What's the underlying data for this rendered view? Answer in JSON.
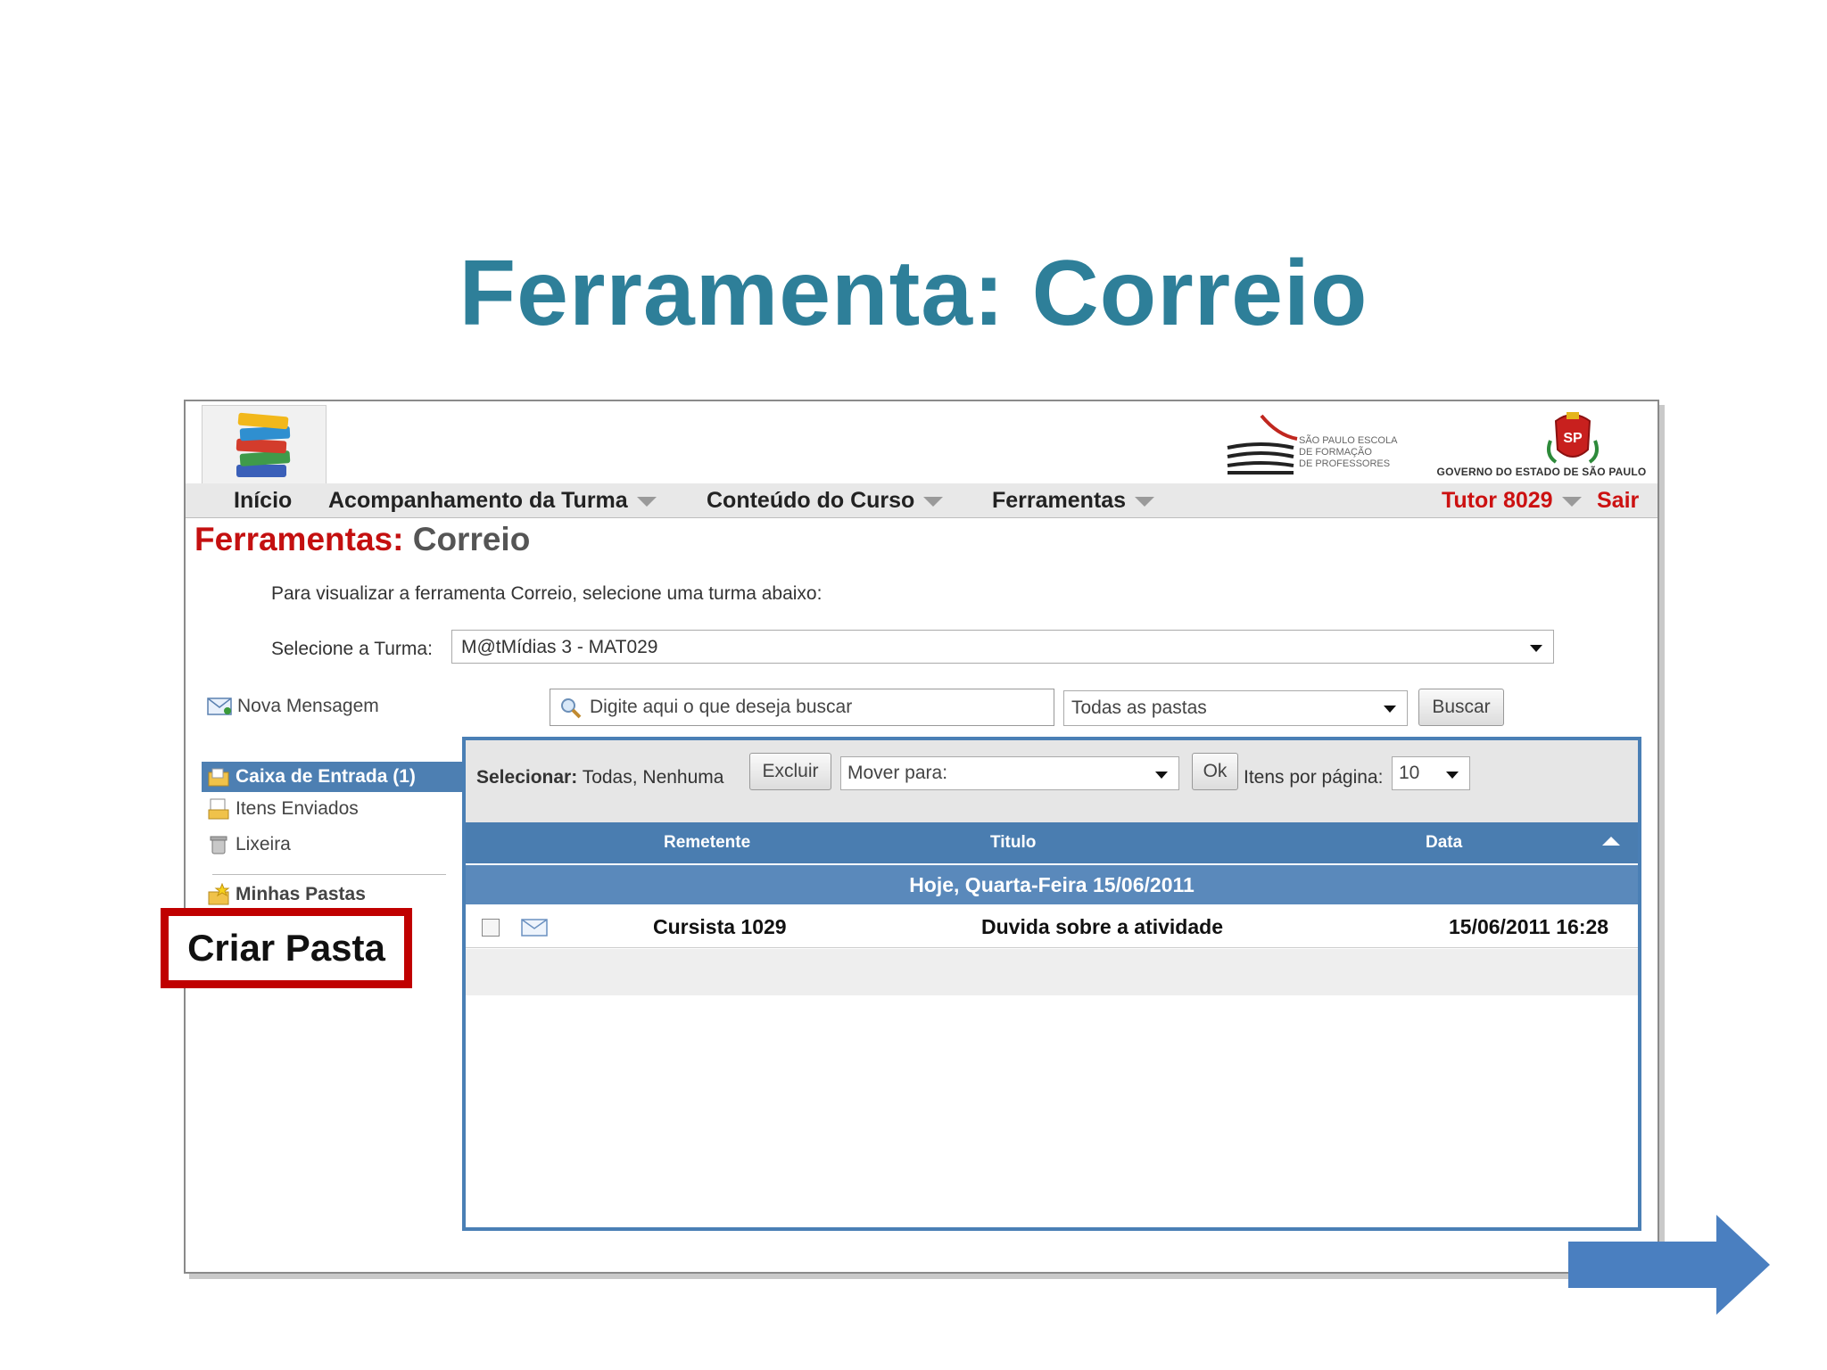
{
  "slide": {
    "title": "Ferramenta: Correio"
  },
  "nav": {
    "home": "Início",
    "acompanhamento": "Acompanhamento da Turma",
    "conteudo": "Conteúdo do Curso",
    "ferramentas": "Ferramentas",
    "tutor": "Tutor 8029",
    "sair": "Sair"
  },
  "logos": {
    "efap_lines": [
      "SÃO PAULO ESCOLA",
      "DE FORMAÇÃO",
      "DE PROFESSORES"
    ],
    "gov": "GOVERNO DO ESTADO DE SÃO PAULO"
  },
  "page": {
    "heading_red": "Ferramentas:",
    "heading_gray": "Correio",
    "intro": "Para visualizar a ferramenta Correio, selecione uma turma abaixo:",
    "select_label": "Selecione a Turma:",
    "select_value": "M@tMídias 3 - MAT029"
  },
  "mail": {
    "new_message": "Nova Mensagem",
    "search_placeholder": "Digite aqui o que deseja buscar",
    "folders_select": "Todas as pastas",
    "search_button": "Buscar"
  },
  "sidebar": {
    "inbox": "Caixa de Entrada (1)",
    "sent": "Itens Enviados",
    "trash": "Lixeira",
    "my_folders": "Minhas Pastas",
    "create_folder": "Criar Pasta"
  },
  "toolbar": {
    "select_label": "Selecionar:",
    "select_all": "Todas,",
    "select_none": "Nenhuma",
    "delete_button": "Excluir",
    "move_placeholder": "Mover para:",
    "ok_button": "Ok",
    "per_page_label": "Itens por página:",
    "per_page_value": "10"
  },
  "table": {
    "headers": [
      "Remetente",
      "Titulo",
      "Data"
    ],
    "group_label": "Hoje, Quarta-Feira 15/06/2011",
    "rows": [
      {
        "sender": "Cursista 1029",
        "title": "Duvida sobre a atividade",
        "date": "15/06/2011 16:28"
      }
    ]
  },
  "colors": {
    "title": "#2e7f99",
    "accent_red": "#c41010",
    "table_blue": "#4a7db0",
    "highlight_box": "#c00000"
  }
}
